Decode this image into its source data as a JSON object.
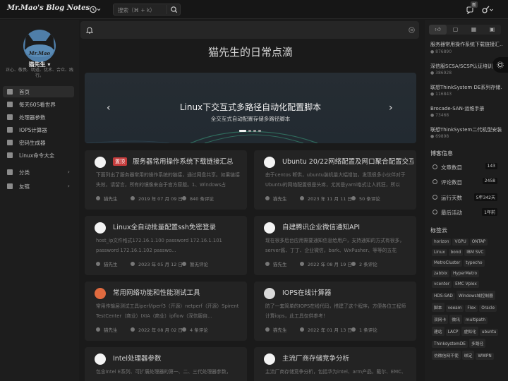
{
  "header": {
    "logo_text": "Mr.Mao's Blog Notes",
    "search_placeholder": "搜索（⌘ + k）",
    "notification_badge": "新"
  },
  "profile": {
    "avatar_text": "Mr.Mao",
    "name": "猫先生",
    "tagline": "正心、敬畏、明道、优术、合众、践行。"
  },
  "nav": [
    {
      "label": "首页",
      "active": true
    },
    {
      "label": "每天60S看世界"
    },
    {
      "label": "处理器参数"
    },
    {
      "label": "IOPS计算器"
    },
    {
      "label": "密码生成器"
    },
    {
      "label": "Linux命令大全"
    },
    {
      "label": "分类",
      "has_children": true
    },
    {
      "label": "友链",
      "has_children": true
    }
  ],
  "main": {
    "site_title": "猫先生的日常点滴",
    "carousel": {
      "title": "Linux下交互式多路径自动化配置脚本",
      "subtitle": "全交互式自动配置存储多路径脚本",
      "slide_count": 4,
      "active_slide": 0
    },
    "posts": [
      {
        "title": "服务器常用操作系统下载链接汇总",
        "tag": "置顶",
        "excerpt": "下面列出了服务器常用的操作系统的链接，通过网盘共享。如果链接失效，请留言，所有的镜像来自于官方原版。1、Windows占",
        "author": "猫先生",
        "date": "2019 年 07 月 09 日",
        "comments": "840 条评论"
      },
      {
        "title": "Ubuntu 20/22网络配置及网口聚合配置交互...",
        "excerpt": "由于centos 断供，ubuntu装机量大幅增加，发现很多小伙伴对于Ubuntu的网络配置很是头疼，尤其是yaml格式让人抓狂，所以",
        "author": "猫先生",
        "date": "2023 年 11 月 11 日",
        "comments": "50 条评论"
      },
      {
        "title": "Linux全自动批量配置ssh免密登录",
        "excerpt": "host_ip文件格式172.16.1.100 password 172.16.1.101 password 172.16.1.102 passwo...",
        "author": "猫先生",
        "date": "2023 年 05 月 12 日",
        "comments": "暂无评论"
      },
      {
        "title": "自建腾讯企业微信通知API",
        "excerpt": "现在很多后台应用需要通知信息给用户，支持通知的方式有很多，server酱、丁丁、企业微信，bark、WxPusher、等等的五花",
        "author": "猫先生",
        "date": "2022 年 08 月 19 日",
        "comments": "2 条评论"
      },
      {
        "title": "常用网络功能和性能测试工具",
        "excerpt": "常用传输层测试工具iperf/iperf3（开源）netperf（开源）Spirent TestCenter（商业）IXIA（商业）ipflow（深信服自...",
        "author": "猫先生",
        "date": "2022 年 08 月 02 日",
        "comments": "4 条评论"
      },
      {
        "title": "IOPS在线计算器",
        "excerpt": "防了一套简单的IOPS在线代码，搭建了这个程序，方便各位工程师计算iops，此工具仅供参考！",
        "author": "猫先生",
        "date": "2022 年 01 月 13 日",
        "comments": "1 条评论"
      },
      {
        "title": "Intel处理器参数",
        "excerpt": "包含Intel E系列、可扩展处理器的第一、二、三代处理器参数，",
        "author": "猫先生",
        "date": "",
        "comments": ""
      },
      {
        "title": "主流厂商存储竞争分析",
        "excerpt": "主流厂商存储竞争分析，包括华为intel、arm产品，戴尔、EMC、",
        "author": "猫先生",
        "date": "",
        "comments": ""
      }
    ]
  },
  "right": {
    "popular": [
      {
        "title": "服务器常用操作系统下载链接汇...",
        "views": "876890"
      },
      {
        "title": "深信服SCSA/SCSP认证培训资...",
        "views": "386928"
      },
      {
        "title": "联想ThinkSystem DE系列存储...",
        "views": "116843"
      },
      {
        "title": "Brocade-SAN-运维手册",
        "views": "73468"
      },
      {
        "title": "联想ThinkSystem二代机型安装...",
        "views": "69898"
      }
    ],
    "stats_title": "博客信息",
    "stats": [
      {
        "label": "文章数目",
        "value": "143"
      },
      {
        "label": "评论数目",
        "value": "2458"
      },
      {
        "label": "运行天数",
        "value": "5年342天"
      },
      {
        "label": "最后活动",
        "value": "1年前"
      }
    ],
    "tags_title": "标签云",
    "tags": [
      "horizon",
      "VGPU",
      "ONTAP",
      "Linux",
      "bond",
      "IBM SVC",
      "MetroCluster",
      "typecho",
      "zabbix",
      "HyperMetro",
      "vcenter",
      "EMC Vplex",
      "HDS-SAD",
      "Windows域控制器",
      "脚本",
      "veeam",
      "Flex",
      "Oracle",
      "双网卡",
      "微讯",
      "multipath",
      "建站",
      "LACP",
      "虚拟化",
      "ubuntu",
      "ThinksystemDE",
      "多路径",
      "仿微信网不使",
      "绑定",
      "WWPN"
    ]
  },
  "colors": {
    "accent_tag": "#c43c3c",
    "background": "#1a1a1a",
    "card": "#232323"
  }
}
